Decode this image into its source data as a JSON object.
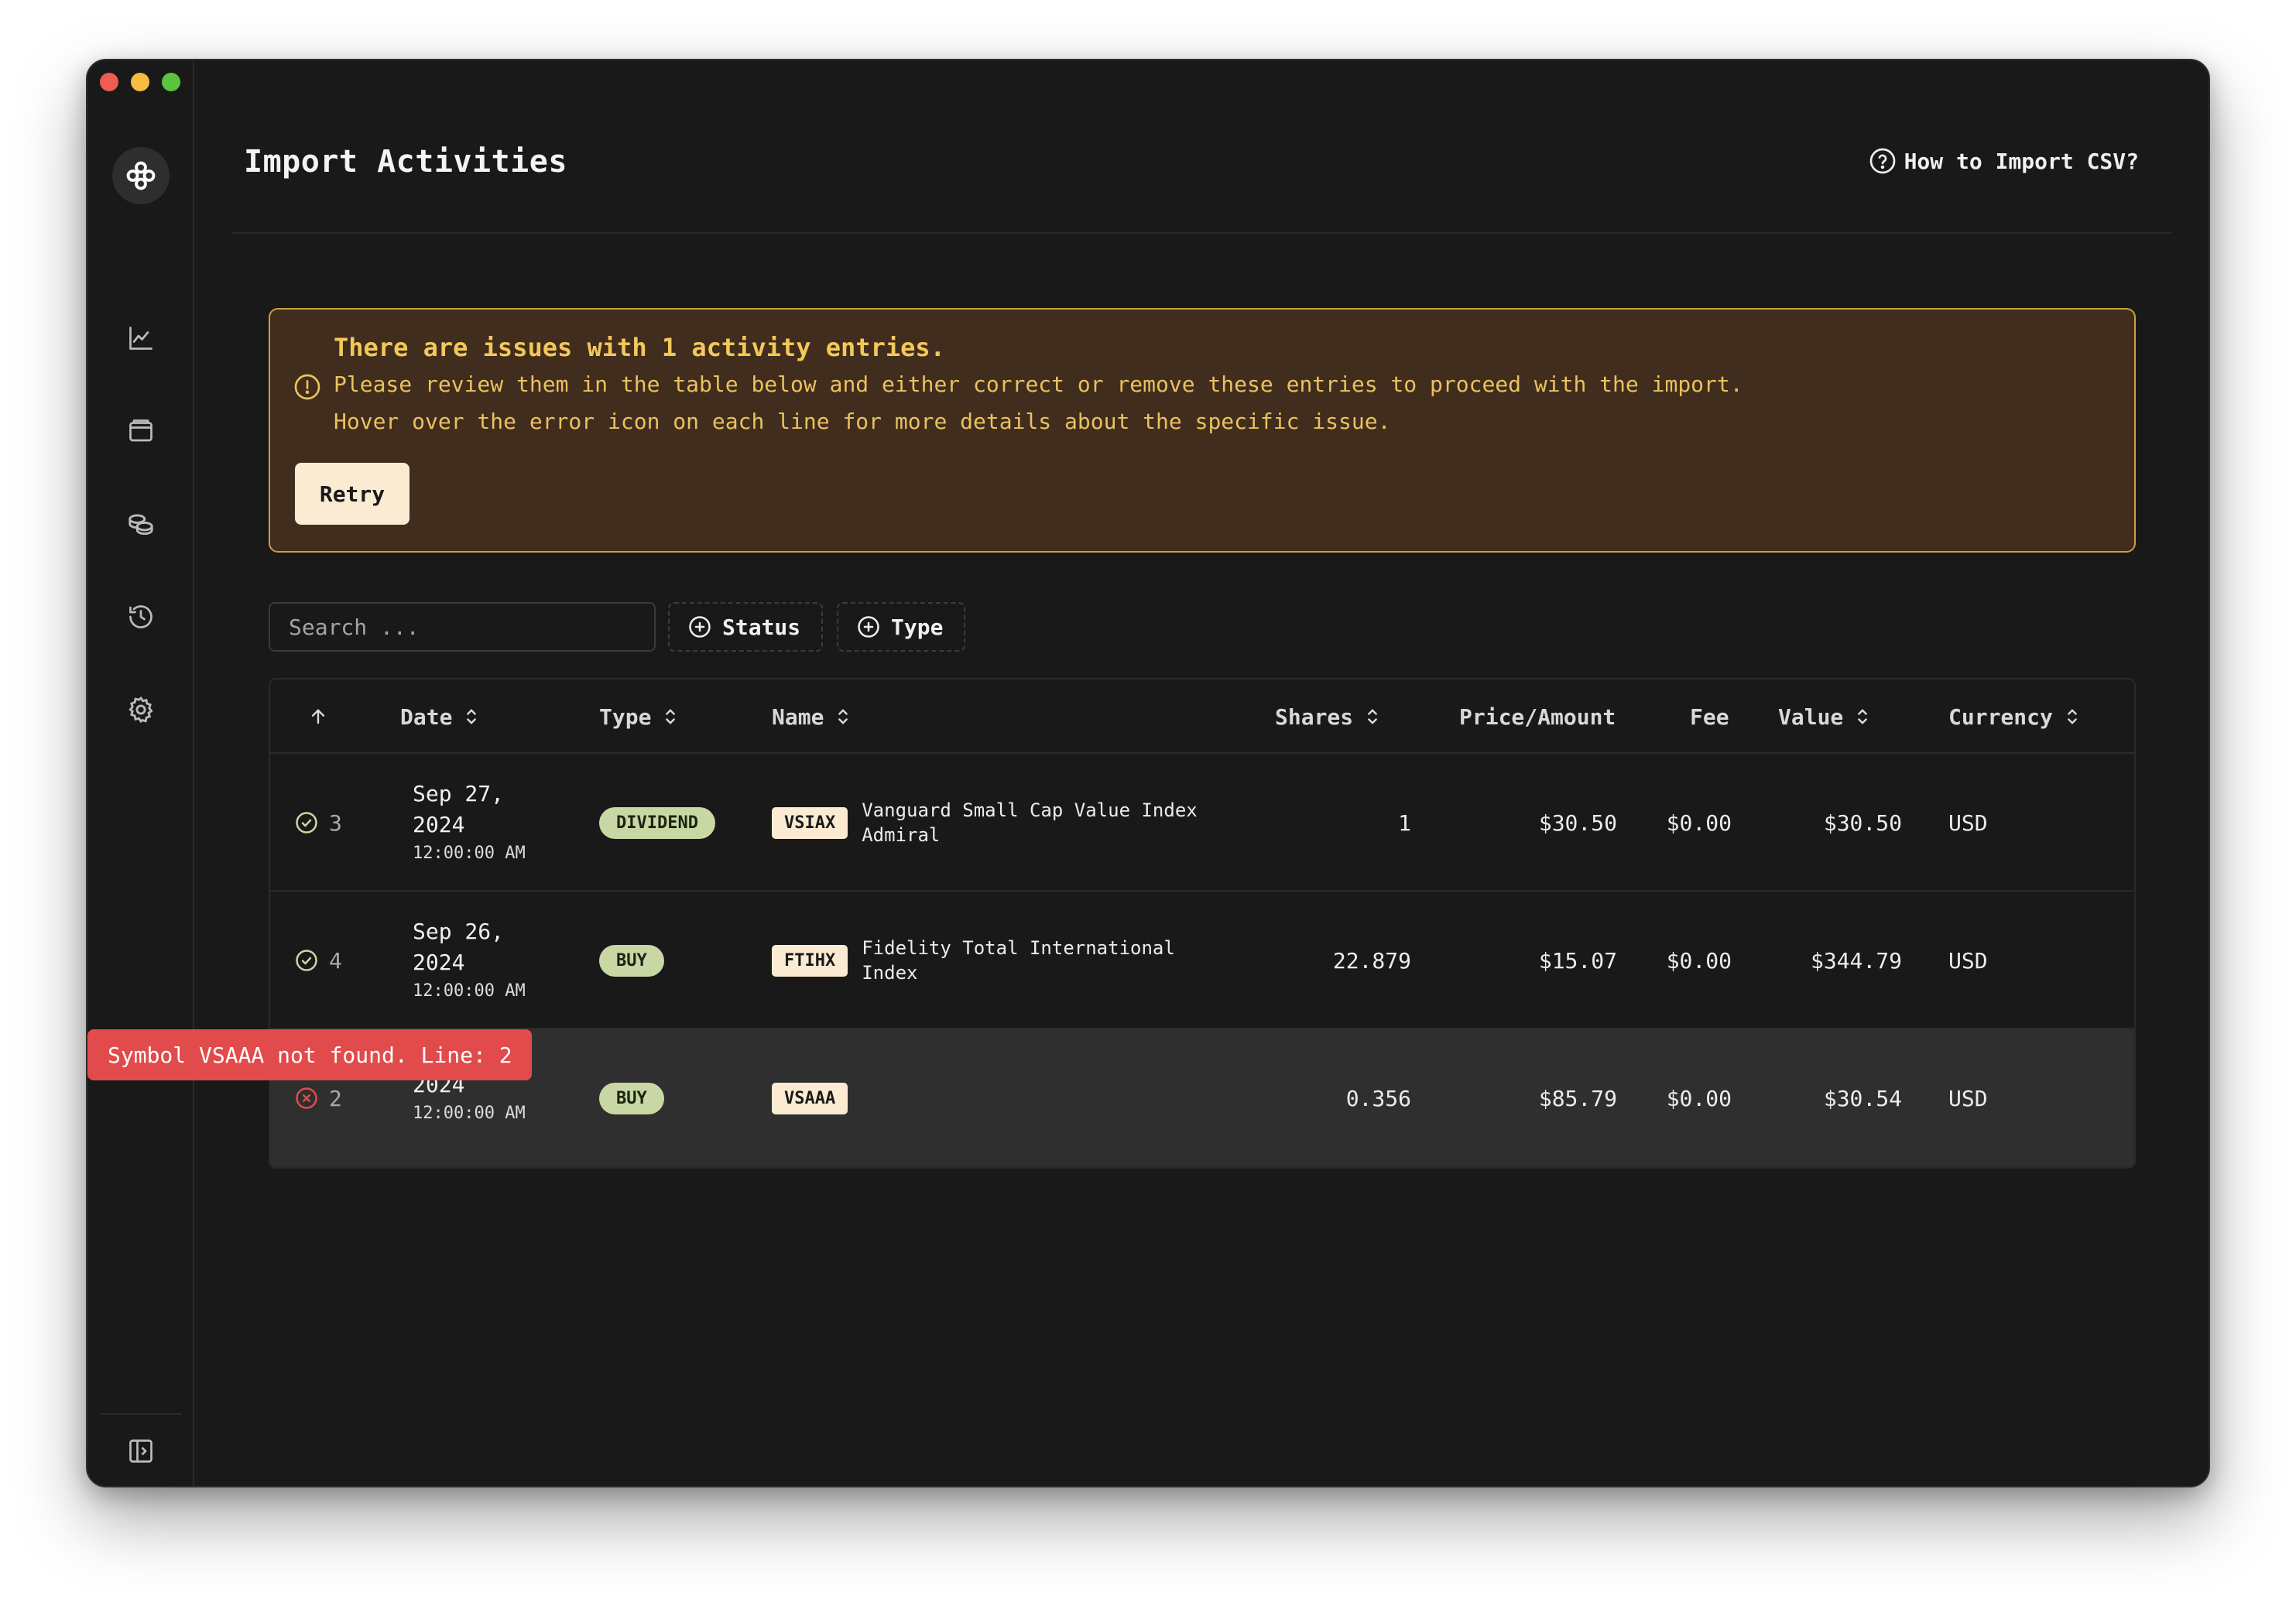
{
  "colors": {
    "accent_warning": "#c8a03d",
    "error": "#e14b4b",
    "success": "#c9d7a4",
    "background": "#191919"
  },
  "header": {
    "title": "Import Activities",
    "help_link": "How to Import CSV?"
  },
  "sidebar": {
    "icons": [
      "app-logo-icon",
      "chart-line-icon",
      "wallet-icon",
      "coins-icon",
      "history-icon",
      "gear-icon",
      "panel-toggle-icon"
    ]
  },
  "alert": {
    "title": "There are issues with 1 activity entries.",
    "line1": "Please review them in the table below and either correct or remove these entries to proceed with the import.",
    "line2": "Hover over the error icon on each line for more details about the specific issue.",
    "retry_label": "Retry"
  },
  "filters": {
    "search_placeholder": "Search ...",
    "status_label": "Status",
    "type_label": "Type"
  },
  "table": {
    "headers": {
      "date": "Date",
      "type": "Type",
      "name": "Name",
      "shares": "Shares",
      "price": "Price/Amount",
      "fee": "Fee",
      "value": "Value",
      "currency": "Currency"
    },
    "rows": [
      {
        "status": "valid",
        "line": "3",
        "date": "Sep 27,",
        "year": "2024",
        "time": "12:00:00 AM",
        "type": "DIVIDEND",
        "symbol": "VSIAX",
        "name": "Vanguard Small Cap Value Index Admiral",
        "shares": "1",
        "price": "$30.50",
        "fee": "$0.00",
        "value": "$30.50",
        "currency": "USD"
      },
      {
        "status": "valid",
        "line": "4",
        "date": "Sep 26,",
        "year": "2024",
        "time": "12:00:00 AM",
        "type": "BUY",
        "symbol": "FTIHX",
        "name": "Fidelity Total International Index",
        "shares": "22.879",
        "price": "$15.07",
        "fee": "$0.00",
        "value": "$344.79",
        "currency": "USD"
      },
      {
        "status": "error",
        "line": "2",
        "date": "",
        "year": "2024",
        "time": "12:00:00 AM",
        "type": "BUY",
        "symbol": "VSAAA",
        "name": "",
        "shares": "0.356",
        "price": "$85.79",
        "fee": "$0.00",
        "value": "$30.54",
        "currency": "USD"
      }
    ]
  },
  "tooltip": {
    "text": "Symbol VSAAA not found. Line: 2"
  }
}
